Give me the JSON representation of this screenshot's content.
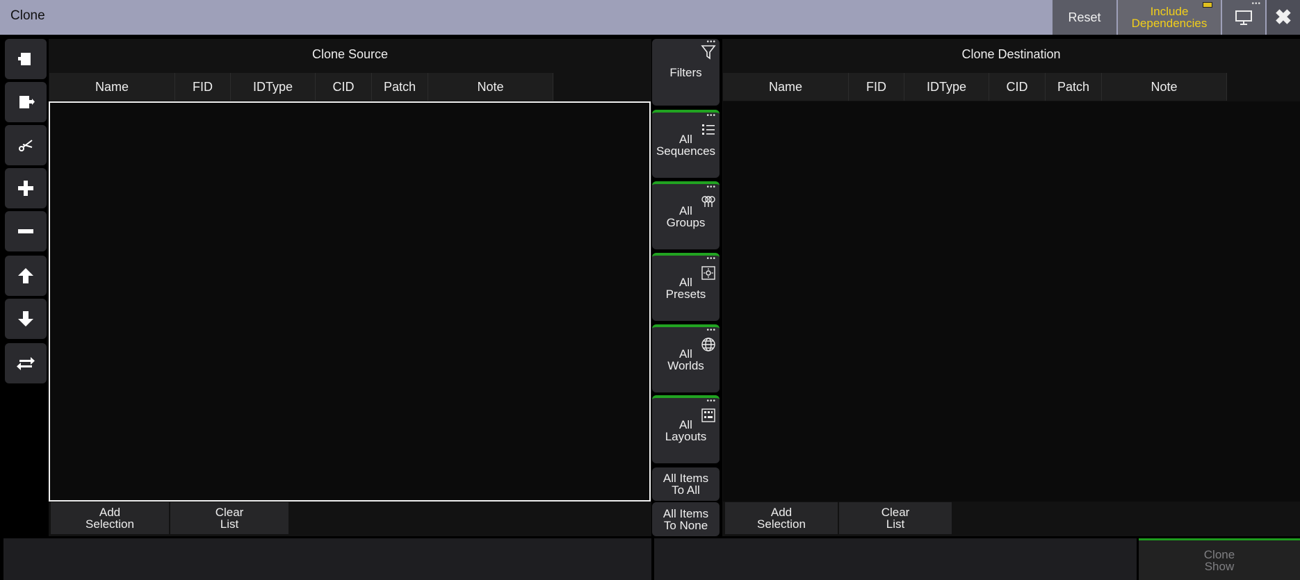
{
  "window": {
    "title": "Clone"
  },
  "topbar": {
    "reset_label": "Reset",
    "include_deps_label": "Include\nDependencies"
  },
  "source": {
    "title": "Clone Source",
    "columns": [
      "Name",
      "FID",
      "IDType",
      "CID",
      "Patch",
      "Note"
    ],
    "add_selection_label": "Add\nSelection",
    "clear_list_label": "Clear\nList"
  },
  "destination": {
    "title": "Clone Destination",
    "columns": [
      "Name",
      "FID",
      "IDType",
      "CID",
      "Patch",
      "Note"
    ],
    "add_selection_label": "Add\nSelection",
    "clear_list_label": "Clear\nList"
  },
  "filters": {
    "filters_label": "Filters",
    "items": [
      {
        "label": "All\nSequences",
        "icon": "list-icon"
      },
      {
        "label": "All\nGroups",
        "icon": "lights-icon"
      },
      {
        "label": "All\nPresets",
        "icon": "preset-icon"
      },
      {
        "label": "All\nWorlds",
        "icon": "globe-icon"
      },
      {
        "label": "All\nLayouts",
        "icon": "layout-icon"
      }
    ],
    "all_to_all_label": "All Items\nTo All",
    "all_to_none_label": "All Items\nTo None"
  },
  "footer": {
    "clone_show_label": "Clone\nShow"
  },
  "colors": {
    "accent_green": "#21a321",
    "title_bar": "#9ea0b9",
    "deps_text": "#f2cf1a"
  }
}
